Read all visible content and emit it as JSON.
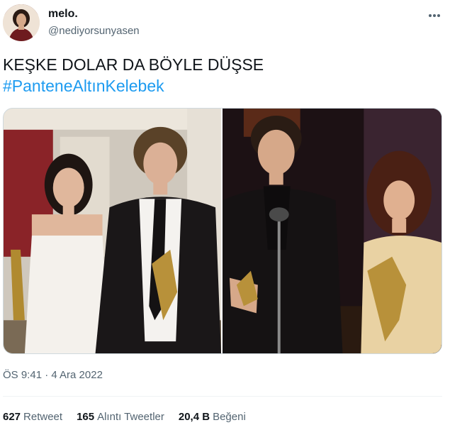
{
  "user": {
    "display_name": "melo.",
    "handle": "@nediyorsunyasen"
  },
  "tweet": {
    "text_line1": "KEŞKE DOLAR DA BÖYLE DÜŞSE",
    "hashtag": "#PanteneAltınKelebek",
    "timestamp": "ÖS 9:41 · 4 Ara 2022"
  },
  "media": {
    "photos": [
      "left-photo",
      "right-photo"
    ]
  },
  "stats": {
    "retweets_count": "627",
    "retweets_label": "Retweet",
    "quotes_count": "165",
    "quotes_label": "Alıntı Tweetler",
    "likes_count": "20,4 B",
    "likes_label": "Beğeni"
  },
  "colors": {
    "accent": "#1d9bf0",
    "text": "#0f1419",
    "secondary": "#536471"
  },
  "icons": {
    "more": "more-horizontal-icon"
  }
}
